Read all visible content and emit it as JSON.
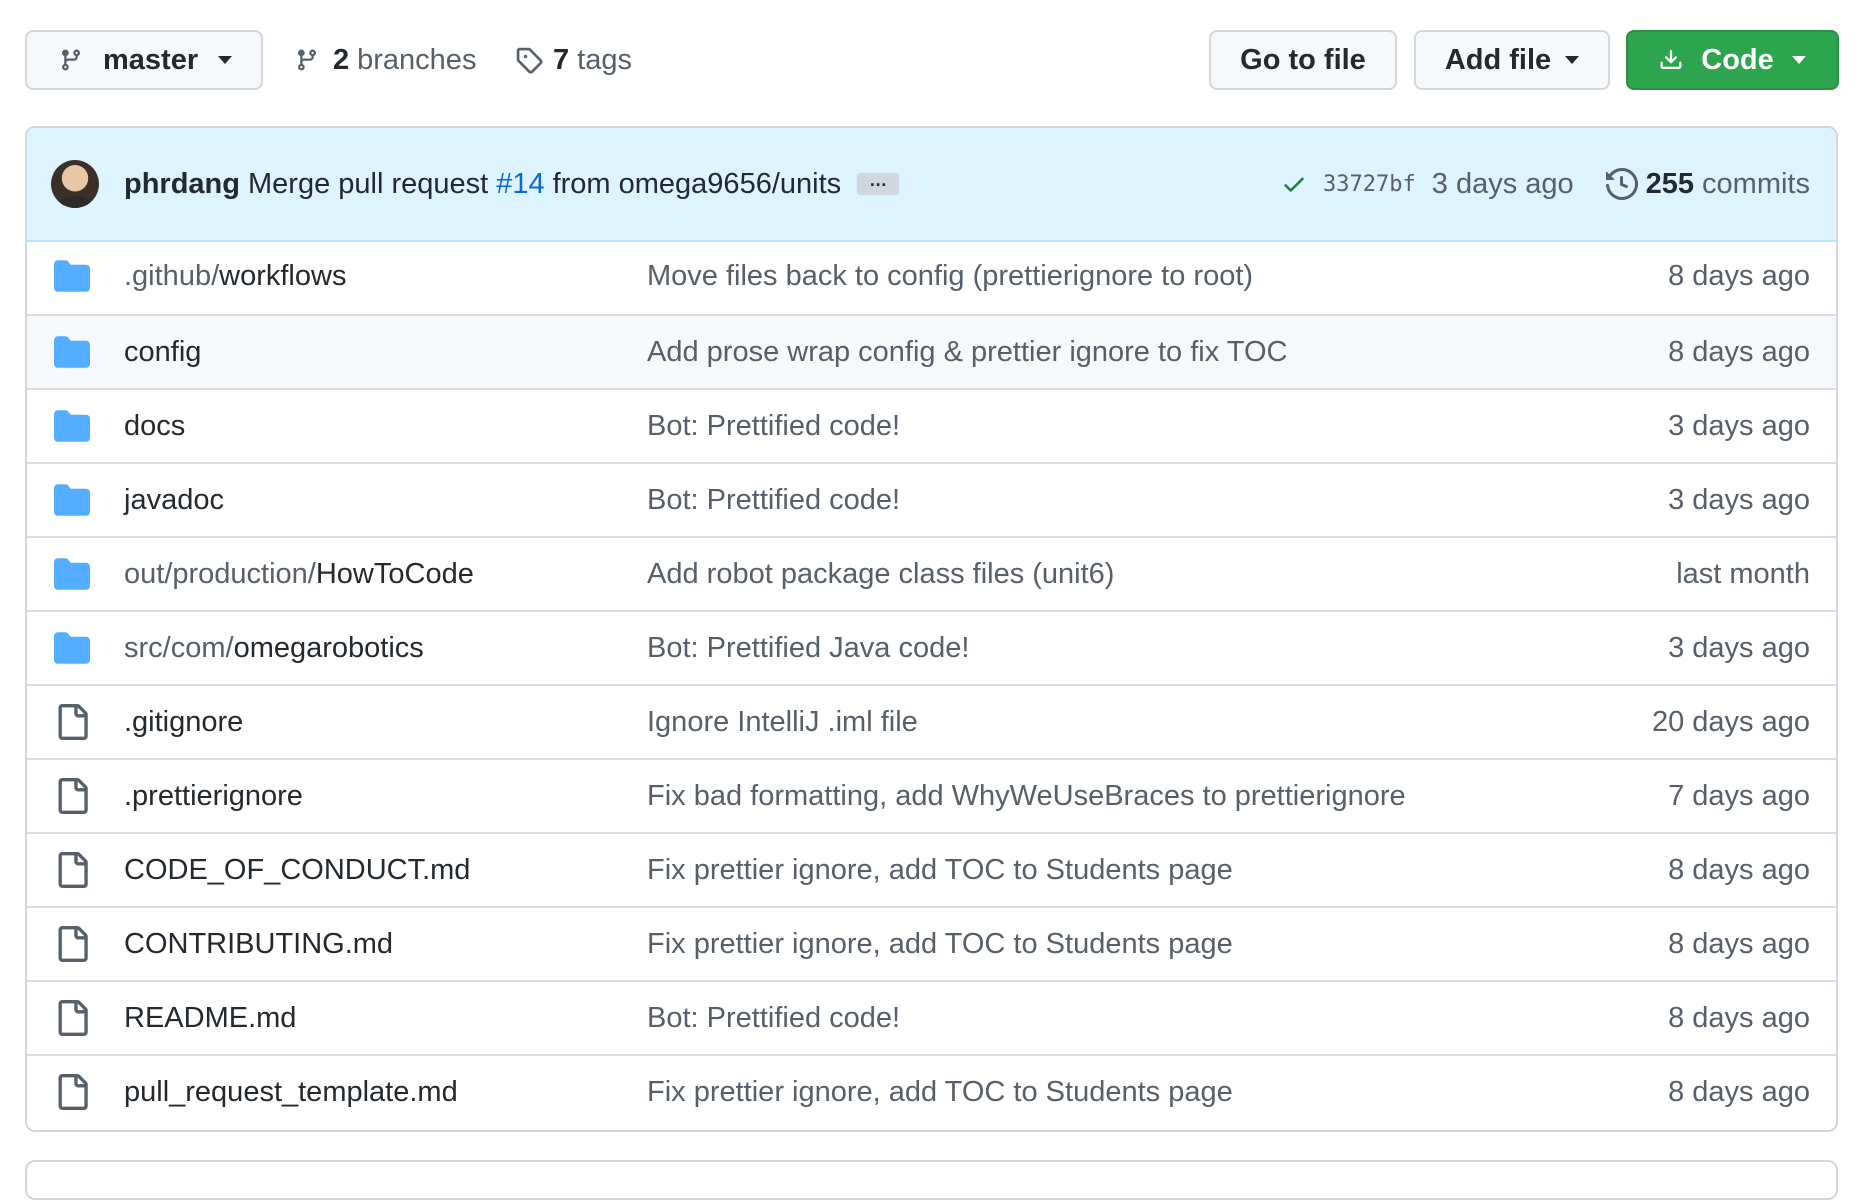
{
  "toolbar": {
    "branch": "master",
    "branches_count": "2",
    "branches_label": "branches",
    "tags_count": "7",
    "tags_label": "tags",
    "go_to_file": "Go to file",
    "add_file": "Add file",
    "code": "Code"
  },
  "commit": {
    "author": "phrdang",
    "message_start": "Merge pull request",
    "pr_link": "#14",
    "message_end": "from omega9656/units",
    "ellipsis": "…",
    "sha": "33727bf",
    "age": "3 days ago",
    "commits_count": "255",
    "commits_label": "commits"
  },
  "files": [
    {
      "type": "folder",
      "prefix": ".github/",
      "name": "workflows",
      "message": "Move files back to config (prettierignore to root)",
      "age": "8 days ago"
    },
    {
      "type": "folder",
      "prefix": "",
      "name": "config",
      "message": "Add prose wrap config & prettier ignore to fix TOC",
      "age": "8 days ago"
    },
    {
      "type": "folder",
      "prefix": "",
      "name": "docs",
      "message": "Bot: Prettified code!",
      "age": "3 days ago"
    },
    {
      "type": "folder",
      "prefix": "",
      "name": "javadoc",
      "message": "Bot: Prettified code!",
      "age": "3 days ago"
    },
    {
      "type": "folder",
      "prefix": "out/production/",
      "name": "HowToCode",
      "message": "Add robot package class files (unit6)",
      "age": "last month"
    },
    {
      "type": "folder",
      "prefix": "src/com/",
      "name": "omegarobotics",
      "message": "Bot: Prettified Java code!",
      "age": "3 days ago"
    },
    {
      "type": "file",
      "prefix": "",
      "name": ".gitignore",
      "message": "Ignore IntelliJ .iml file",
      "age": "20 days ago"
    },
    {
      "type": "file",
      "prefix": "",
      "name": ".prettierignore",
      "message": "Fix bad formatting, add WhyWeUseBraces to prettierignore",
      "age": "7 days ago"
    },
    {
      "type": "file",
      "prefix": "",
      "name": "CODE_OF_CONDUCT.md",
      "message": "Fix prettier ignore, add TOC to Students page",
      "age": "8 days ago"
    },
    {
      "type": "file",
      "prefix": "",
      "name": "CONTRIBUTING.md",
      "message": "Fix prettier ignore, add TOC to Students page",
      "age": "8 days ago"
    },
    {
      "type": "file",
      "prefix": "",
      "name": "README.md",
      "message": "Bot: Prettified code!",
      "age": "8 days ago"
    },
    {
      "type": "file",
      "prefix": "",
      "name": "pull_request_template.md",
      "message": "Fix prettier ignore, add TOC to Students page",
      "age": "8 days ago"
    }
  ],
  "colors": {
    "folder": "#54aeff",
    "file_icon": "#57606a",
    "code_button": "#2da44e",
    "link": "#0969da",
    "commit_bar": "#ddf4ff",
    "check": "#1a7f37"
  }
}
